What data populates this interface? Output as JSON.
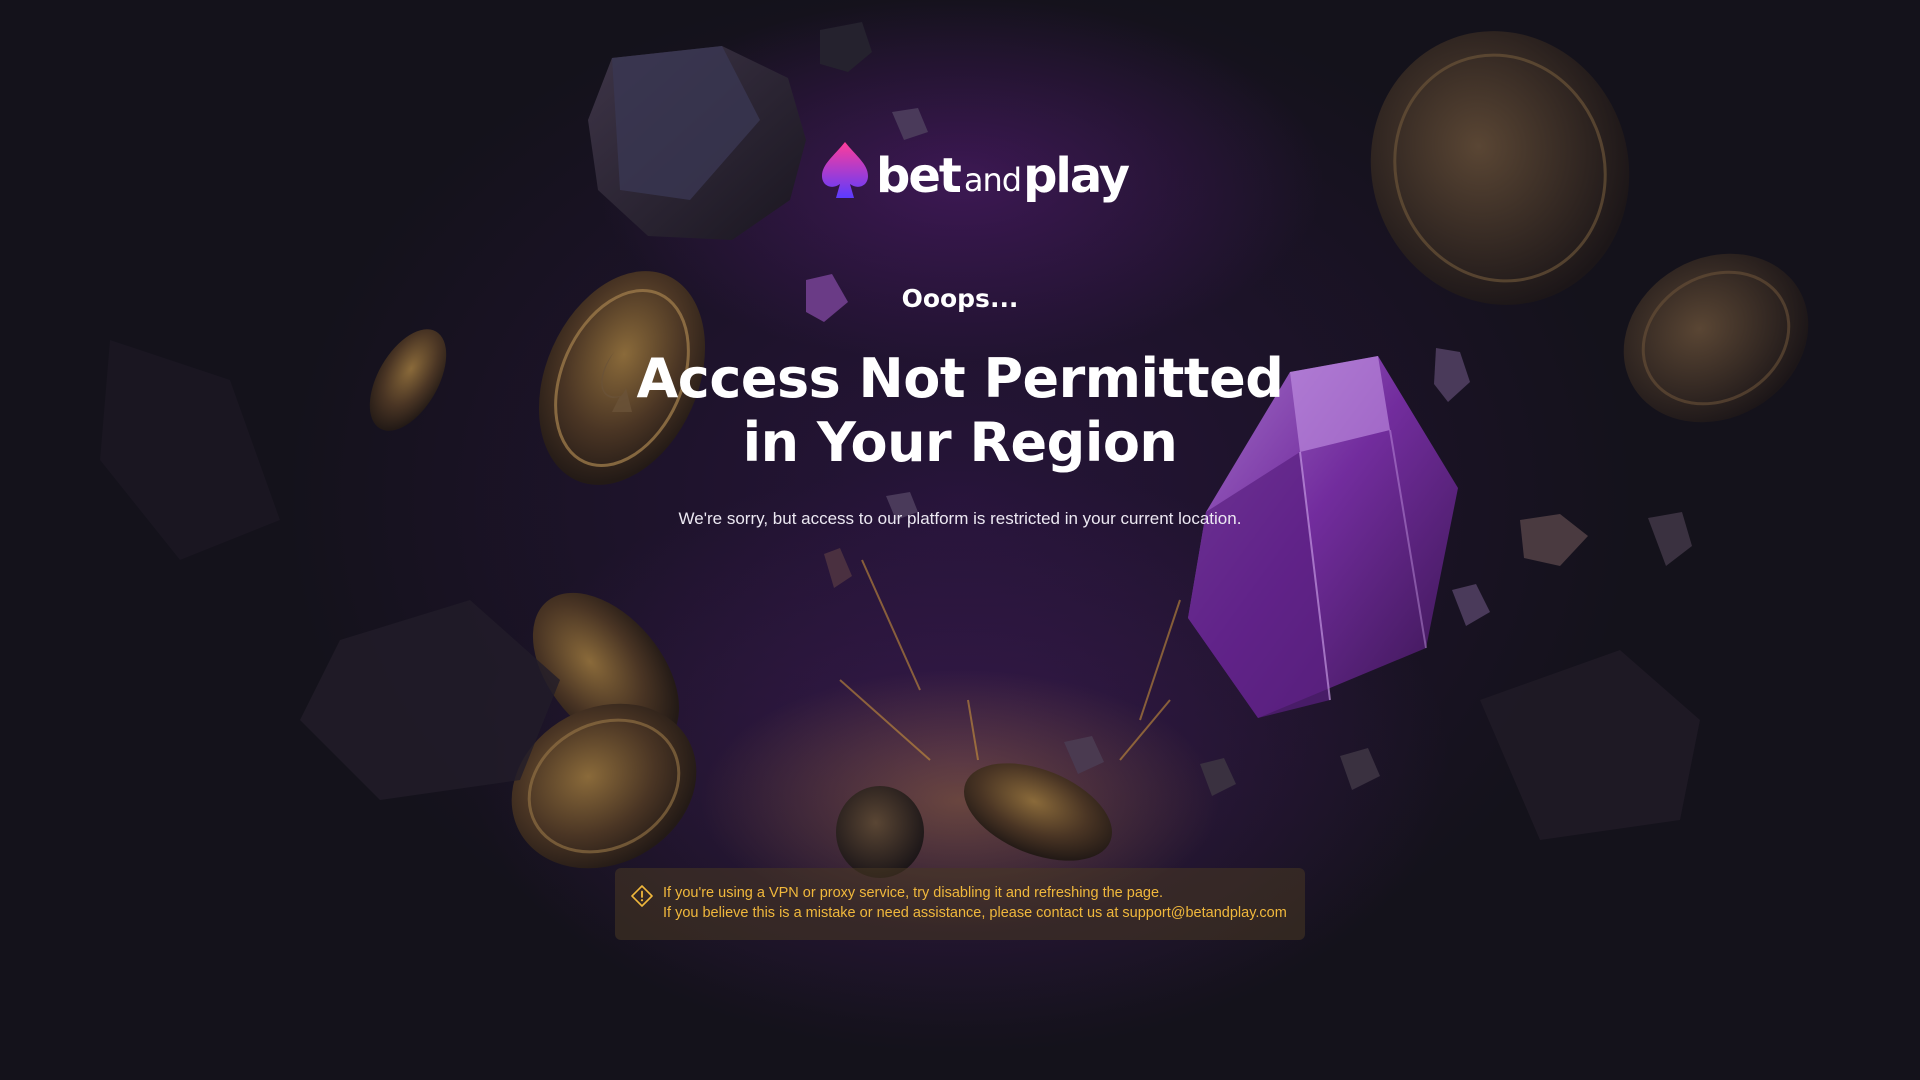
{
  "brand": {
    "logo_bet": "bet",
    "logo_and": "and",
    "logo_play": "play",
    "colors": {
      "spade_top": "#ff3d9a",
      "spade_bottom": "#5b3bff",
      "text": "#ffffff"
    }
  },
  "main": {
    "eyebrow": "Ooops...",
    "headline_line1": "Access Not Permitted",
    "headline_line2": "in Your Region",
    "subtitle": "We're sorry, but access to our platform is restricted in your current location."
  },
  "notice": {
    "icon": "warning-diamond-icon",
    "line1": "If you're using a VPN or proxy service, try disabling it and refreshing the page.",
    "line2": "If you believe this is a mistake or need assistance, please contact us at support@betandplay.com",
    "color": "#f0b83c"
  },
  "theme": {
    "background": "#14121b",
    "accent_purple": "#7a2fb0",
    "accent_gold": "#d49a3a"
  }
}
